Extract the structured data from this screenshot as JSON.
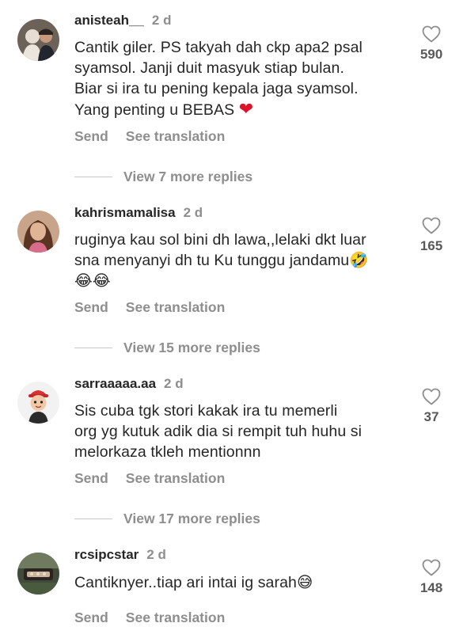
{
  "comments": [
    {
      "username": "anisteah__",
      "age": "2 d",
      "lines": [
        "Cantik giler. PS takyah dah ckp apa2 psal",
        "syamsol. Janji duit masyuk stiap bulan.",
        "Biar si ira tu pening kepala jaga syamsol.",
        "Yang penting u BEBAS"
      ],
      "emoji": "❤",
      "likes": "590",
      "send": "Send",
      "translate": "See translation",
      "replies": "View 7 more replies"
    },
    {
      "username": "kahrismamalisa",
      "age": "2 d",
      "lines": [
        "ruginya kau sol bini dh lawa,,lelaki dkt luar",
        "sna menyanyi dh tu Ku tunggu jandamu🤣",
        "😂😂"
      ],
      "likes": "165",
      "send": "Send",
      "translate": "See translation",
      "replies": "View 15 more replies"
    },
    {
      "username": "sarraaaaa.aa",
      "age": "2 d",
      "lines": [
        "Sis cuba tgk stori kakak ira tu memerli",
        "org yg kutuk adik dia si rempit tuh huhu si",
        "melorkaza tkleh mentionnn"
      ],
      "likes": "37",
      "send": "Send",
      "translate": "See translation",
      "replies": "View 17 more replies"
    },
    {
      "username": "rcsipcstar",
      "age": "2 d",
      "lines": [
        "Cantiknyer..tiap ari intai ig sarah😅"
      ],
      "likes": "148",
      "send": "Send",
      "translate": "See translation"
    }
  ]
}
